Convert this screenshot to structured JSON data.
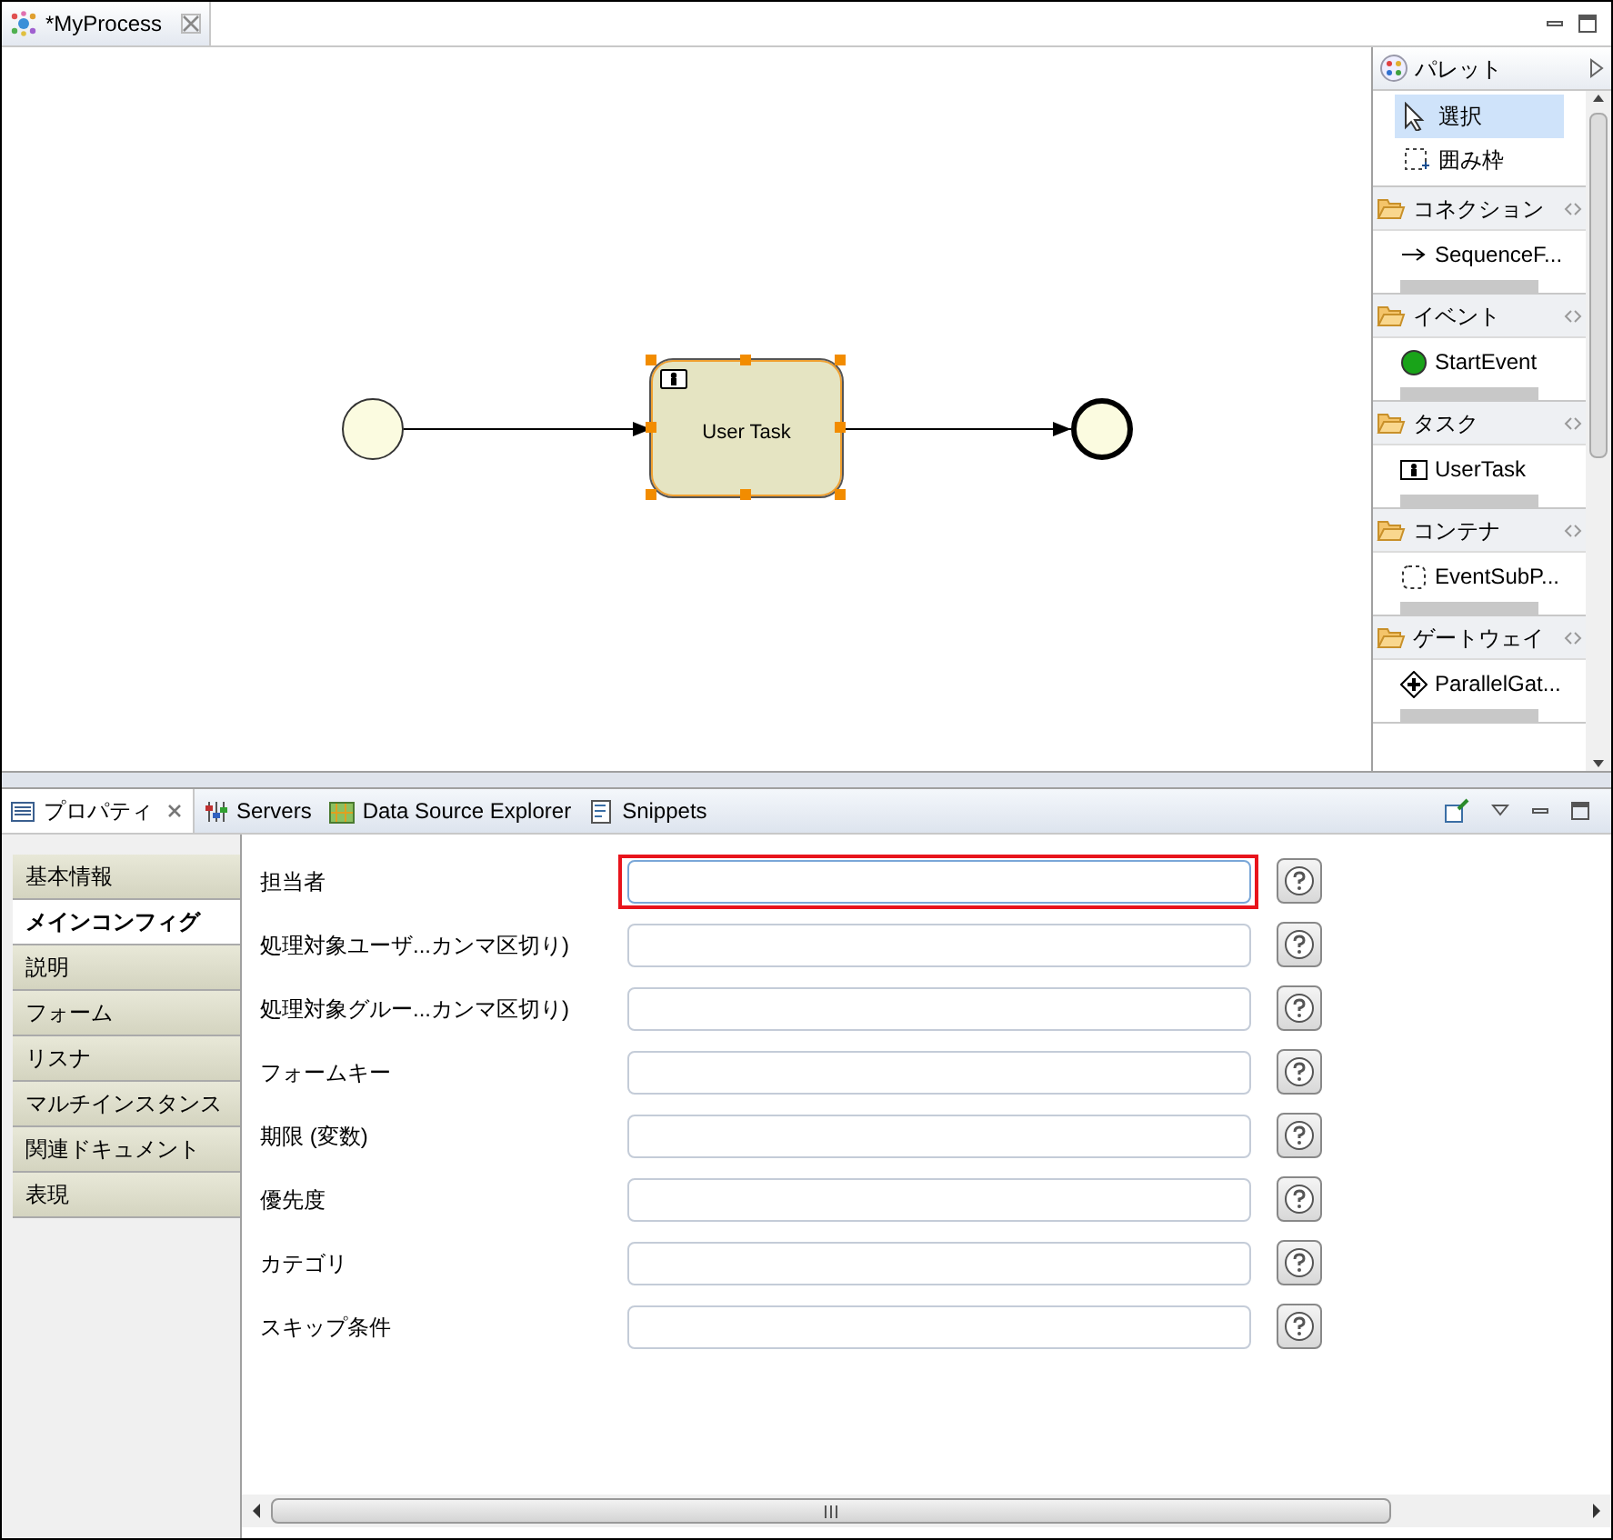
{
  "editor_tab": {
    "title": "*MyProcess"
  },
  "diagram": {
    "nodes": [
      {
        "kind": "start_event"
      },
      {
        "kind": "user_task",
        "label": "User Task",
        "selected": true
      },
      {
        "kind": "end_event"
      }
    ]
  },
  "palette": {
    "title": "パレット",
    "tools": [
      {
        "kind": "select",
        "label": "選択",
        "selected": true
      },
      {
        "kind": "marquee",
        "label": "囲み枠",
        "selected": false
      }
    ],
    "drawers": [
      {
        "label": "コネクション",
        "items": [
          {
            "kind": "arrow",
            "label": "SequenceF..."
          }
        ]
      },
      {
        "label": "イベント",
        "items": [
          {
            "kind": "start",
            "label": "StartEvent"
          }
        ]
      },
      {
        "label": "タスク",
        "items": [
          {
            "kind": "task",
            "label": "UserTask"
          }
        ]
      },
      {
        "label": "コンテナ",
        "items": [
          {
            "kind": "subprocess",
            "label": "EventSubP..."
          }
        ]
      },
      {
        "label": "ゲートウェイ",
        "items": [
          {
            "kind": "gateway",
            "label": "ParallelGat..."
          }
        ]
      }
    ]
  },
  "view_tabs": [
    {
      "kind": "properties",
      "label": "プロパティ",
      "selected": true
    },
    {
      "kind": "servers",
      "label": "Servers",
      "selected": false
    },
    {
      "kind": "datasource",
      "label": "Data Source Explorer",
      "selected": false
    },
    {
      "kind": "snippets",
      "label": "Snippets",
      "selected": false
    }
  ],
  "sections": [
    {
      "label": "基本情報",
      "selected": false
    },
    {
      "label": "メインコンフィグ",
      "selected": true
    },
    {
      "label": "説明",
      "selected": false
    },
    {
      "label": "フォーム",
      "selected": false
    },
    {
      "label": "リスナ",
      "selected": false
    },
    {
      "label": "マルチインスタンス",
      "selected": false
    },
    {
      "label": "関連ドキュメント",
      "selected": false
    },
    {
      "label": "表現",
      "selected": false
    }
  ],
  "fields": [
    {
      "label": "担当者",
      "highlighted": true
    },
    {
      "label": "処理対象ユーザ...カンマ区切り)",
      "highlighted": false
    },
    {
      "label": "処理対象グルー...カンマ区切り)",
      "highlighted": false
    },
    {
      "label": "フォームキー",
      "highlighted": false
    },
    {
      "label": "期限 (変数)",
      "highlighted": false
    },
    {
      "label": "優先度",
      "highlighted": false
    },
    {
      "label": "カテゴリ",
      "highlighted": false
    },
    {
      "label": "スキップ条件",
      "highlighted": false
    }
  ]
}
